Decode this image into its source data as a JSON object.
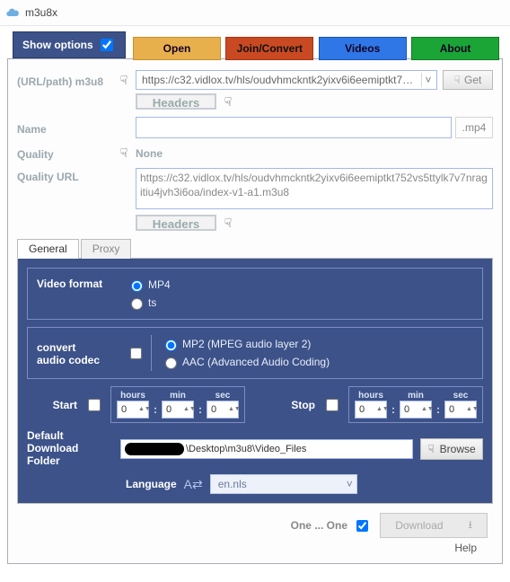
{
  "window": {
    "title": "m3u8x"
  },
  "show_options": {
    "label": "Show options",
    "checked": true
  },
  "top_tabs": {
    "open": "Open",
    "join": "Join/Convert",
    "videos": "Videos",
    "about": "About"
  },
  "labels": {
    "url": "(URL/path) m3u8",
    "name": "Name",
    "quality": "Quality",
    "quality_url": "Quality URL",
    "headers": "Headers",
    "get": "Get",
    "ext": ".mp4",
    "quality_value": "None"
  },
  "url_value": "https://c32.vidlox.tv/hls/oudvhmckntk2yixv6i6eemiptkt752vs5ttylk7",
  "name_value": "",
  "quality_url_value": "https://c32.vidlox.tv/hls/oudvhmckntk2yixv6i6eemiptkt752vs5ttylk7v7nragitiu4jvh3i6oa/index-v1-a1.m3u8",
  "sub_tabs": {
    "general": "General",
    "proxy": "Proxy"
  },
  "general": {
    "video_format_label": "Video format",
    "video_format": {
      "mp4": "MP4",
      "ts": "ts",
      "selected": "mp4"
    },
    "convert_label": "convert\naudio codec",
    "convert_checked": false,
    "codec": {
      "mp2": "MP2 (MPEG audio layer 2)",
      "aac": "AAC (Advanced Audio Coding)",
      "selected": "mp2"
    },
    "start_label": "Start",
    "stop_label": "Stop",
    "time_headers": {
      "hours": "hours",
      "min": "min",
      "sec": "sec"
    },
    "start": {
      "checked": false,
      "h": "0",
      "m": "0",
      "s": "0"
    },
    "stop": {
      "checked": false,
      "h": "0",
      "m": "0",
      "s": "0"
    },
    "dl_label": "Default\nDownload Folder",
    "dl_path_tail": "\\Desktop\\m3u8\\Video_Files",
    "browse": "Browse",
    "language_label": "Language",
    "language_value": "en.nls"
  },
  "footer": {
    "one_one": "One ... One",
    "one_one_checked": true,
    "download": "Download",
    "help": "Help"
  }
}
